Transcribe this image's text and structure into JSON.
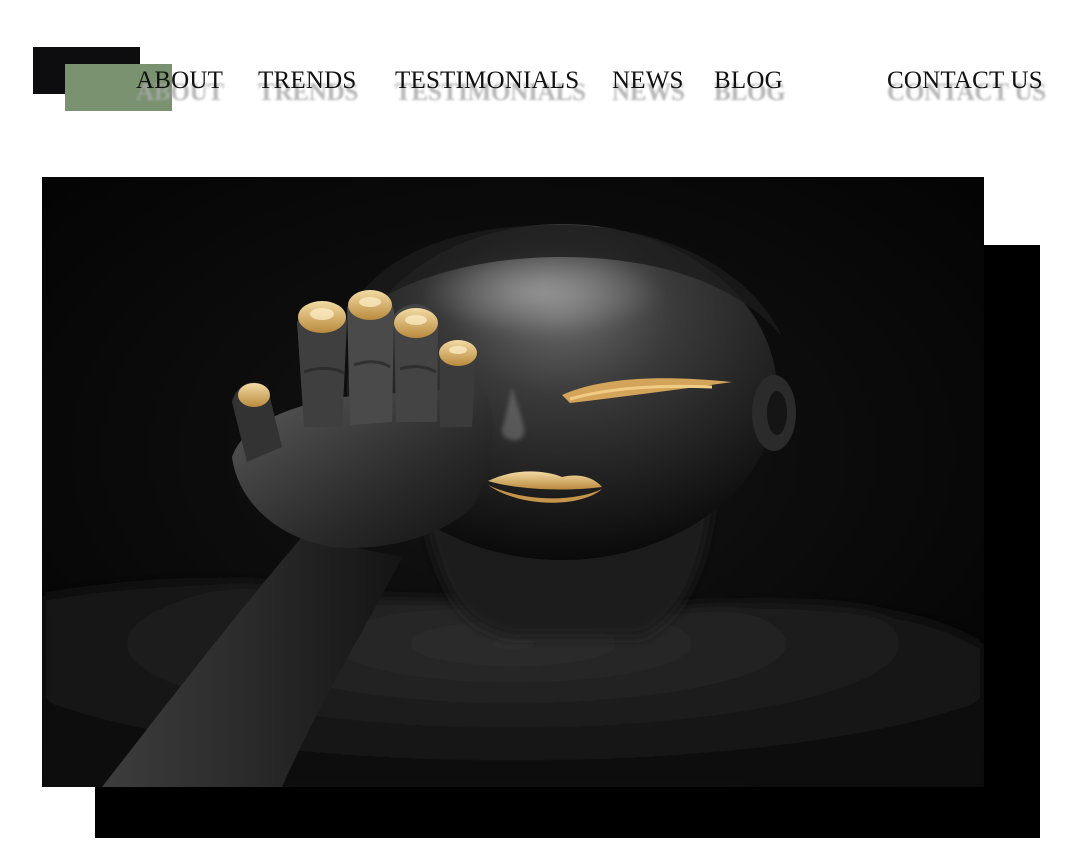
{
  "nav": {
    "items": [
      {
        "label": "ABOUT"
      },
      {
        "label": "TRENDS"
      },
      {
        "label": "TESTIMONIALS"
      },
      {
        "label": "NEWS"
      },
      {
        "label": "BLOG"
      },
      {
        "label": "CONTACT US"
      }
    ]
  },
  "colors": {
    "logo_dark": "#0d0d10",
    "logo_green": "#7a9270",
    "gold": "#d9b36a",
    "background": "#ffffff"
  },
  "hero": {
    "image": "portrait-gold-makeup-photo"
  }
}
